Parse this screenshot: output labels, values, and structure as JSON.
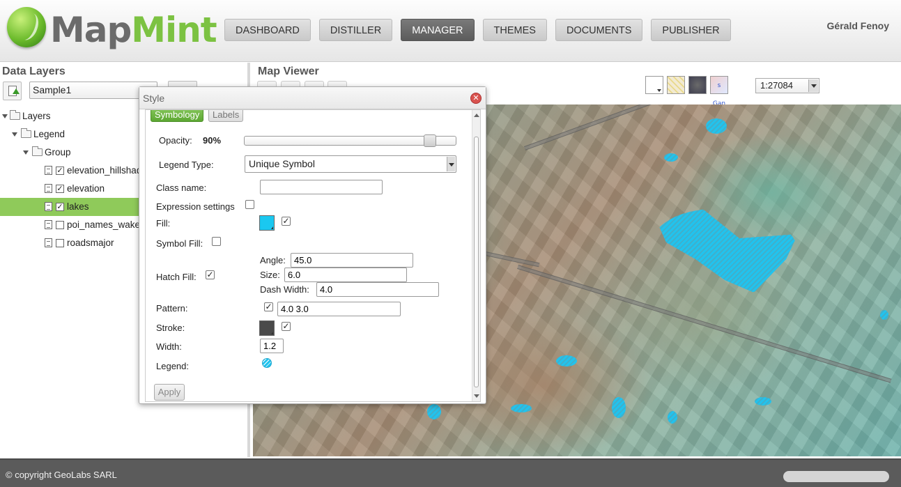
{
  "app": {
    "logo_text": "MapMint"
  },
  "header": {
    "nav": [
      "DASHBOARD",
      "DISTILLER",
      "MANAGER",
      "THEMES",
      "DOCUMENTS",
      "PUBLISHER"
    ],
    "active_nav": "MANAGER",
    "user": "Gérald Fenoy"
  },
  "data_layers": {
    "title": "Data Layers",
    "map_name": "Sample1",
    "tree": {
      "root": "Layers",
      "legend": "Legend",
      "group": "Group",
      "layers": [
        {
          "name": "elevation_hillshade",
          "checked": true,
          "selected": false
        },
        {
          "name": "elevation",
          "checked": true,
          "selected": false
        },
        {
          "name": "lakes",
          "checked": true,
          "selected": true
        },
        {
          "name": "poi_names_wake",
          "checked": false,
          "selected": false
        },
        {
          "name": "roadsmajor",
          "checked": false,
          "selected": false
        }
      ]
    }
  },
  "map_viewer": {
    "title": "Map Viewer",
    "scale": "1:27084",
    "basemaps": [
      "blank",
      "streets",
      "satellite",
      "osm"
    ],
    "basemap_label_fragment": "s Gan"
  },
  "style_dialog": {
    "title": "Style",
    "tabs": [
      "Symbology",
      "Labels"
    ],
    "active_tab": "Symbology",
    "opacity_label": "Opacity:",
    "opacity_value": "90%",
    "opacity_fraction": 0.9,
    "legend_type_label": "Legend Type:",
    "legend_type_value": "Unique Symbol",
    "class_name_label": "Class name:",
    "class_name_value": "",
    "expression_label": "Expression settings",
    "fill_label": "Fill:",
    "fill_color": "#1ac8f0",
    "symbol_fill_label": "Symbol Fill:",
    "hatch_fill_label": "Hatch Fill:",
    "angle_label": "Angle:",
    "angle_value": "45.0",
    "size_label": "Size:",
    "size_value": "6.0",
    "dash_width_label": "Dash Width:",
    "dash_width_value": "4.0",
    "pattern_label": "Pattern:",
    "pattern_value": "4.0 3.0",
    "stroke_label": "Stroke:",
    "stroke_color": "#4a4a4a",
    "width_label": "Width:",
    "width_value": "1.2",
    "legend_label": "Legend:",
    "apply_label": "Apply"
  },
  "footer": {
    "copyright": "© copyright  GeoLabs SARL"
  }
}
